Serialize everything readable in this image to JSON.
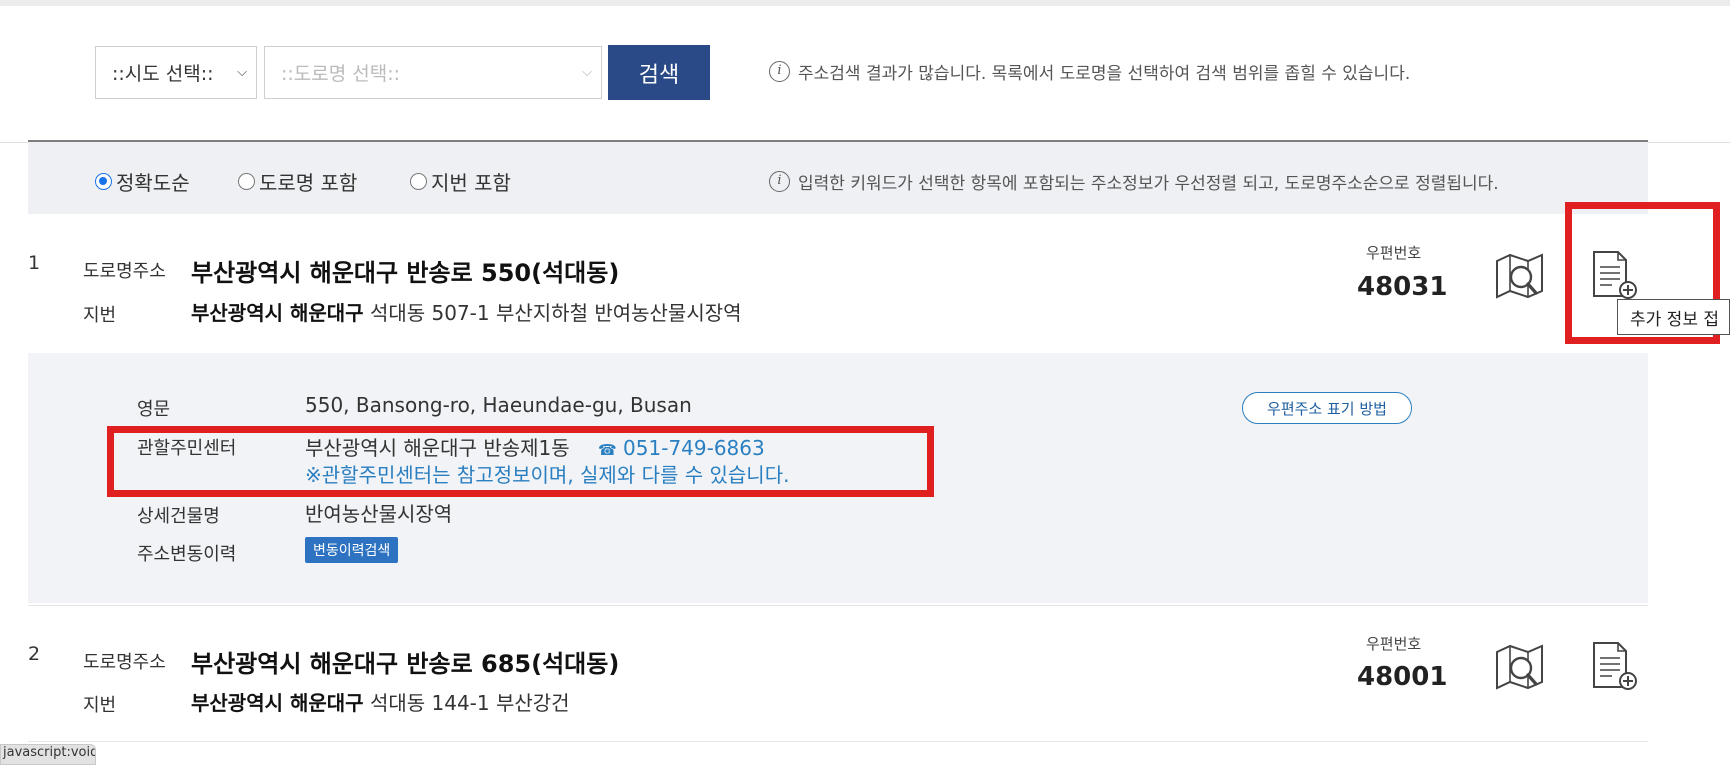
{
  "search": {
    "sido_placeholder": "::시도 선택::",
    "road_placeholder": "::도로명 선택::",
    "search_label": "검색",
    "info": "주소검색 결과가 많습니다. 목록에서 도로명을 선택하여 검색 범위를 좁힐 수 있습니다."
  },
  "sort": {
    "options": [
      {
        "label": "정확도순",
        "selected": true
      },
      {
        "label": "도로명 포함",
        "selected": false
      },
      {
        "label": "지번 포함",
        "selected": false
      }
    ],
    "info": "입력한 키워드가 선택한 항목에 포함되는 주소정보가 우선정렬 되고, 도로명주소순으로 정렬됩니다."
  },
  "labels": {
    "road_addr": "도로명주소",
    "jibun": "지번",
    "zip": "우편번호",
    "info_icon": "i"
  },
  "results": [
    {
      "num": "1",
      "road_addr": "부산광역시 해운대구 반송로 550(석대동)",
      "jibun_bold": "부산광역시 해운대구",
      "jibun_rest": "석대동 507-1 부산지하철 반여농산물시장역",
      "zip": "48031"
    },
    {
      "num": "2",
      "road_addr": "부산광역시 해운대구 반송로 685(석대동)",
      "jibun_bold": "부산광역시 해운대구",
      "jibun_rest": "석대동 144-1 부산강건",
      "zip": "48001"
    }
  ],
  "detail": {
    "eng_label": "영문",
    "eng_value": "550, Bansong-ro, Haeundae-gu, Busan",
    "center_label": "관할주민센터",
    "center_value": "부산광역시 해운대구 반송제1동",
    "phone_icon": "☎",
    "center_phone": "051-749-6863",
    "center_note": "※관할주민센터는 참고정보이며, 실제와 다를 수 있습니다.",
    "building_label": "상세건물명",
    "building_value": "반여농산물시장역",
    "history_label": "주소변동이력",
    "history_button": "변동이력검색",
    "postal_guide": "우편주소 표기 방법"
  },
  "tooltip": "추가 정보 접",
  "statusbar": "javascript:void(0);",
  "colors": {
    "accent": "#2a4a87",
    "highlight": "#e02020",
    "link": "#2a7fc1"
  }
}
